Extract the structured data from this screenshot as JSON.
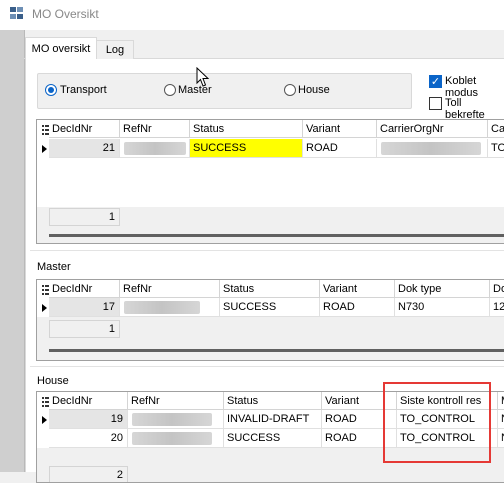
{
  "window": {
    "title": "MO Oversikt"
  },
  "tabs": [
    {
      "label": "MO oversikt",
      "active": true
    },
    {
      "label": "Log",
      "active": false
    }
  ],
  "mode_radio": {
    "options": [
      {
        "label": "Transport",
        "checked": true
      },
      {
        "label": "Master",
        "checked": false
      },
      {
        "label": "House",
        "checked": false
      }
    ]
  },
  "options": {
    "koblet_modus": {
      "label": "Koblet modus",
      "checked": true
    },
    "toll_bekreftet": {
      "label": "Toll bekrefte",
      "checked": false
    }
  },
  "transport_grid": {
    "columns": [
      "DecIdNr",
      "RefNr",
      "Status",
      "Variant",
      "CarrierOrgNr",
      "Ca"
    ],
    "rows": [
      {
        "DecIdNr": "21",
        "Status": "SUCCESS",
        "Variant": "ROAD",
        "Ca": "TO"
      }
    ],
    "footer_count": "1",
    "highlight_color": "#ffff00"
  },
  "master_grid": {
    "label": "Master",
    "columns": [
      "DecIdNr",
      "RefNr",
      "Status",
      "Variant",
      "Dok type",
      "Do"
    ],
    "rows": [
      {
        "DecIdNr": "17",
        "Status": "SUCCESS",
        "Variant": "ROAD",
        "DokType": "N730",
        "Do": "12"
      }
    ],
    "footer_count": "1"
  },
  "house_grid": {
    "label": "House",
    "columns": [
      "DecIdNr",
      "RefNr",
      "Status",
      "Variant",
      "Siste kontroll res",
      "M"
    ],
    "rows": [
      {
        "DecIdNr": "19",
        "Status": "INVALID-DRAFT",
        "Variant": "ROAD",
        "Siste": "TO_CONTROL",
        "M": "N"
      },
      {
        "DecIdNr": "20",
        "Status": "SUCCESS",
        "Variant": "ROAD",
        "Siste": "TO_CONTROL",
        "M": "N"
      }
    ],
    "footer_count": "2",
    "annotation_color": "#e53935"
  }
}
